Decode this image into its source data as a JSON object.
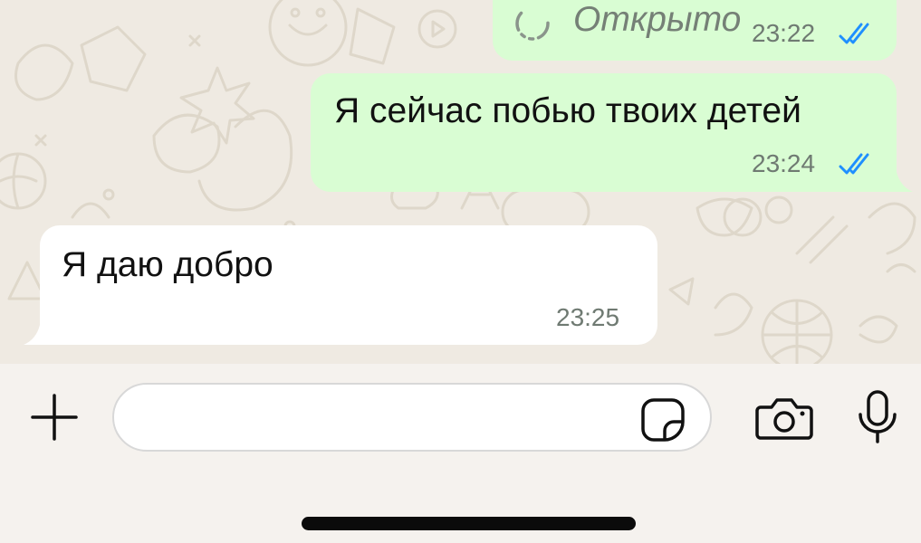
{
  "chat": {
    "messages": [
      {
        "direction": "outgoing",
        "status_text": "Открыто",
        "time": "23:22",
        "read_state": "read"
      },
      {
        "direction": "outgoing",
        "text": "Я сейчас побью твоих детей",
        "time": "23:24",
        "read_state": "read"
      },
      {
        "direction": "incoming",
        "text": "Я даю добро",
        "time": "23:25"
      }
    ]
  },
  "composer": {
    "placeholder": "",
    "value": "",
    "attach_icon": "plus-icon",
    "sticker_icon": "sticker-icon",
    "camera_icon": "camera-icon",
    "mic_icon": "microphone-icon"
  },
  "colors": {
    "outgoing_bubble": "#d9fdd3",
    "incoming_bubble": "#ffffff",
    "chat_background": "#efeae2",
    "read_checks": "#1f8fff"
  }
}
